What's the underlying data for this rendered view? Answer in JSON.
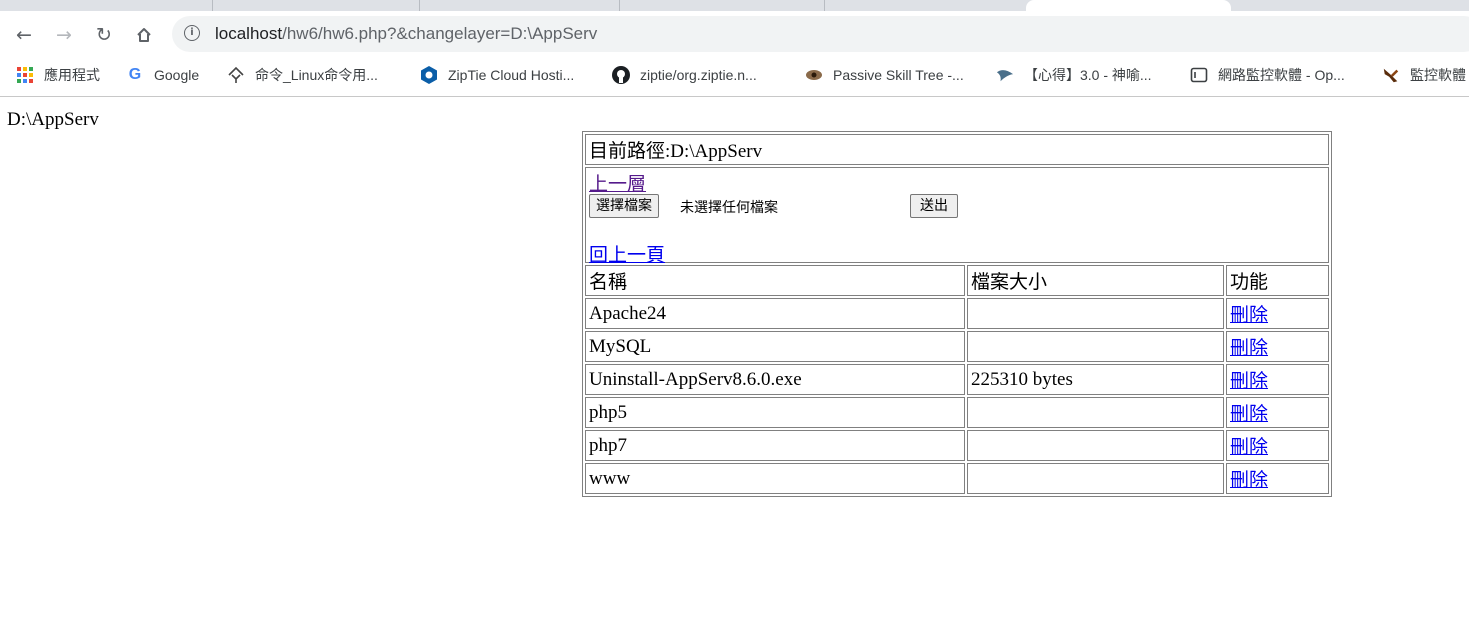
{
  "browser": {
    "url_host": "localhost",
    "url_path": "/hw6/hw6.php?&changelayer=D:\\AppServ",
    "bookmarks": [
      {
        "label": "應用程式",
        "icon": "apps-grid-icon"
      },
      {
        "label": "Google",
        "icon": "google-icon"
      },
      {
        "label": "命令_Linux命令用...",
        "icon": "linux-cmd-icon"
      },
      {
        "label": "ZipTie Cloud Hosti...",
        "icon": "ziptie-icon"
      },
      {
        "label": "ziptie/org.ziptie.n...",
        "icon": "github-icon"
      },
      {
        "label": "Passive Skill Tree -...",
        "icon": "skill-tree-icon"
      },
      {
        "label": "【心得】3.0 - 神喻...",
        "icon": "bird-icon"
      },
      {
        "label": "網路監控軟體 - Op...",
        "icon": "page-icon"
      },
      {
        "label": "監控軟體",
        "icon": "monitor-icon"
      }
    ]
  },
  "page": {
    "current_path": "D:\\AppServ",
    "path_header": "目前路徑:D:\\AppServ",
    "up_level_link": "上一層",
    "choose_file_button": "選擇檔案",
    "no_file_text": "未選擇任何檔案",
    "submit_button": "送出",
    "back_link": "回上一頁",
    "columns": [
      "名稱",
      "檔案大小",
      "功能"
    ],
    "rows": [
      {
        "name": "Apache24",
        "size": "",
        "action": "刪除"
      },
      {
        "name": "MySQL",
        "size": "",
        "action": "刪除"
      },
      {
        "name": "Uninstall-AppServ8.6.0.exe",
        "size": "225310 bytes",
        "action": "刪除"
      },
      {
        "name": "php5",
        "size": "",
        "action": "刪除"
      },
      {
        "name": "php7",
        "size": "",
        "action": "刪除"
      },
      {
        "name": "www",
        "size": "",
        "action": "刪除"
      }
    ]
  }
}
